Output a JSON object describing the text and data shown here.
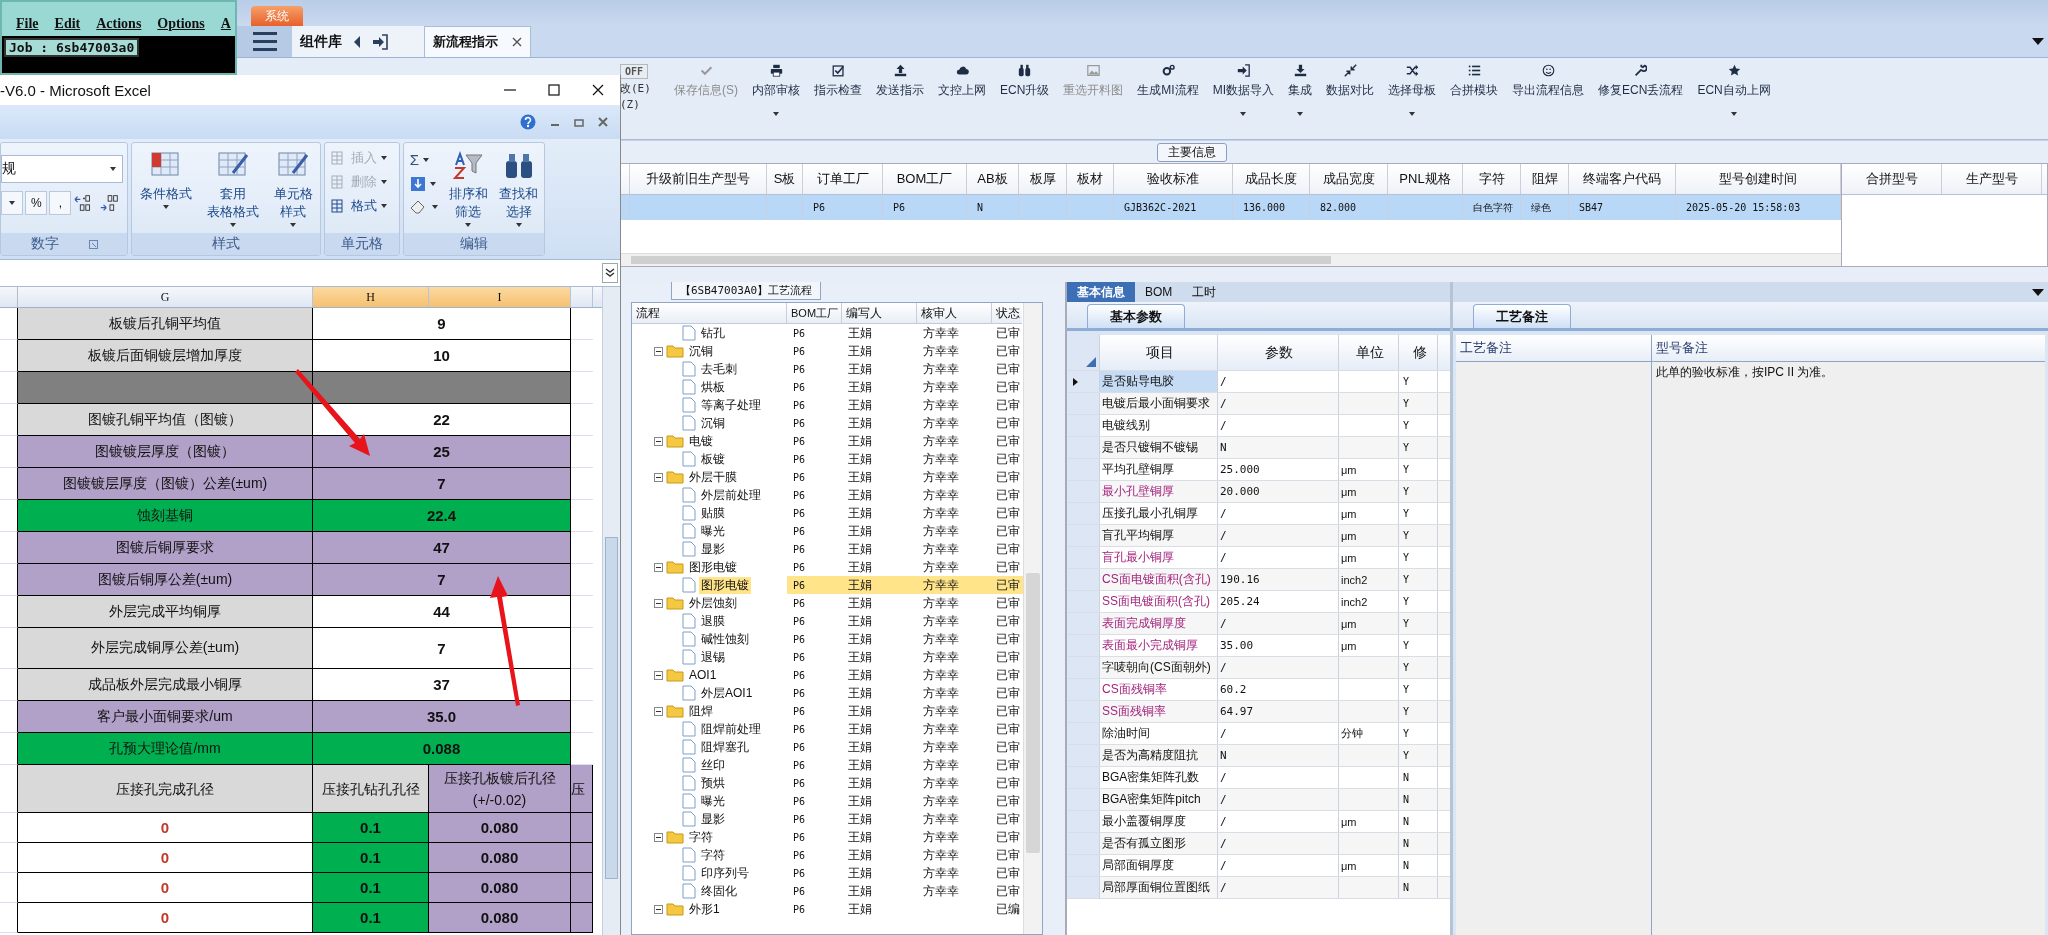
{
  "terminal": {
    "menu": [
      "File",
      "Edit",
      "Actions",
      "Options",
      "A"
    ],
    "job": "Job : 6sb47003a0"
  },
  "excel": {
    "title": "-V6.0 - Microsoft Excel",
    "ribbon": {
      "format_value": "规",
      "number_buttons": [
        "%",
        ","
      ],
      "number_group": "数字",
      "style_group": "样式",
      "style_buttons": [
        {
          "lines": [
            "条件格式"
          ]
        },
        {
          "lines": [
            "套用",
            "表格格式"
          ]
        },
        {
          "lines": [
            "单元格",
            "样式"
          ]
        }
      ],
      "cells_group": "单元格",
      "cells_buttons": [
        {
          "label": "插入",
          "disabled": true
        },
        {
          "label": "删除",
          "disabled": true
        },
        {
          "label": "格式",
          "disabled": false
        }
      ],
      "edit_group": "编辑",
      "sum": "Σ",
      "edit_buttons": [
        {
          "lines": [
            "排序和",
            "筛选"
          ]
        },
        {
          "lines": [
            "查找和",
            "选择"
          ]
        }
      ]
    },
    "columns": [
      "G",
      "H",
      "I"
    ],
    "rows": [
      {
        "label": "板镀后孔铜平均值",
        "value": "9",
        "kind": "plain"
      },
      {
        "label": "板镀后面铜镀层增加厚度",
        "value": "10",
        "kind": "plain"
      },
      {
        "kind": "blank"
      },
      {
        "label": "图镀孔铜平均值（图镀）",
        "value": "22",
        "kind": "plain"
      },
      {
        "label": "图镀镀层厚度（图镀）",
        "value": "25",
        "kind": "purple"
      },
      {
        "label": "图镀镀层厚度（图镀）公差(±um)",
        "value": "7",
        "kind": "purple"
      },
      {
        "label": "蚀刻基铜",
        "value": "22.4",
        "kind": "green"
      },
      {
        "label": "图镀后铜厚要求",
        "value": "47",
        "kind": "purple"
      },
      {
        "label": "图镀后铜厚公差(±um)",
        "value": "7",
        "kind": "purple"
      },
      {
        "label": "外层完成平均铜厚",
        "value": "44",
        "kind": "plain"
      },
      {
        "label": "外层完成铜厚公差(±um)",
        "value": "7",
        "kind": "plain"
      },
      {
        "label": "成品板外层完成最小铜厚",
        "value": "37",
        "kind": "plain"
      },
      {
        "label": "客户最小面铜要求/um",
        "value": "35.0",
        "kind": "purple"
      },
      {
        "label": "孔预大理论值/mm",
        "value": "0.088",
        "kind": "green"
      }
    ],
    "press_header": [
      {
        "lines": [
          "压接孔完成孔径"
        ]
      },
      {
        "lines": [
          "压接孔钻孔孔径"
        ]
      },
      {
        "lines": [
          "压接孔板镀后孔径",
          "(+/-0.02)"
        ]
      },
      {
        "lines": [
          "压"
        ]
      }
    ],
    "press_rows": [
      {
        "finished": "0",
        "drill": "0.1",
        "plated": "0.080"
      },
      {
        "finished": "0",
        "drill": "0.1",
        "plated": "0.080"
      },
      {
        "finished": "0",
        "drill": "0.1",
        "plated": "0.080"
      },
      {
        "finished": "0",
        "drill": "0.1",
        "plated": "0.080"
      }
    ]
  },
  "app": {
    "system_tab": "系统",
    "library": "组件库",
    "doc_tab": {
      "label": "新流程指示",
      "selected": true
    },
    "toolbar": {
      "off": "OFF",
      "hints": [
        "改(E)",
        "(Z)"
      ],
      "items": [
        {
          "label": "保存信息(S)",
          "disabled": true,
          "dropdown": false
        },
        {
          "label": "内部审核",
          "disabled": false,
          "dropdown": true
        },
        {
          "label": "指示检查",
          "disabled": false,
          "dropdown": false
        },
        {
          "label": "发送指示",
          "disabled": false,
          "dropdown": false
        },
        {
          "label": "文控上网",
          "disabled": false,
          "dropdown": false
        },
        {
          "label": "ECN升级",
          "disabled": false,
          "dropdown": false
        },
        {
          "label": "重选开料图",
          "disabled": true,
          "dropdown": false
        },
        {
          "label": "生成MI流程",
          "disabled": false,
          "dropdown": false
        },
        {
          "label": "MI数据导入",
          "disabled": false,
          "dropdown": true
        },
        {
          "label": "集成",
          "disabled": false,
          "dropdown": true
        },
        {
          "label": "数据对比",
          "disabled": false,
          "dropdown": false
        },
        {
          "label": "选择母板",
          "disabled": false,
          "dropdown": true
        },
        {
          "label": "合拼模块",
          "disabled": false,
          "dropdown": false
        },
        {
          "label": "导出流程信息",
          "disabled": false,
          "dropdown": false
        },
        {
          "label": "修复ECN丢流程",
          "disabled": false,
          "dropdown": false
        },
        {
          "label": "ECN自动上网",
          "disabled": false,
          "dropdown": true
        }
      ]
    },
    "main_info": {
      "title": "主要信息",
      "columns": [
        "升级前旧生产型号",
        "S板",
        "订单工厂",
        "BOM工厂",
        "AB板",
        "板厚",
        "板材",
        "验收标准",
        "成品长度",
        "成品宽度",
        "PNL规格",
        "字符",
        "阻焊",
        "终端客户代码",
        "型号创建时间"
      ],
      "rows": [
        {
          "selected": true,
          "cells": [
            null,
            null,
            "P6",
            "P6",
            "N",
            null,
            null,
            "GJB362C-2021",
            "136.000",
            "82.000",
            null,
            "白色字符",
            "绿色",
            "SB47",
            "2025-05-20 15:58:03"
          ]
        }
      ],
      "side_columns": [
        "合拼型号",
        "生产型号"
      ]
    },
    "flow": {
      "tab": "【6SB47003A0】工艺流程",
      "columns": [
        "流程",
        "BOM工厂",
        "编写人",
        "核审人",
        "状态"
      ],
      "tree": [
        {
          "name": "钻孔",
          "kind": "file",
          "bom": "P6",
          "writer": "王娟",
          "reviewer": "方幸幸",
          "status": "已审",
          "selected": false
        },
        {
          "name": "沉铜",
          "kind": "folder",
          "expanded": true,
          "bom": "P6",
          "writer": "王娟",
          "reviewer": "方幸幸",
          "status": "已审",
          "selected": false,
          "children": [
            {
              "name": "去毛刺",
              "kind": "file",
              "bom": "P6",
              "writer": "王娟",
              "reviewer": "方幸幸",
              "status": "已审",
              "selected": false
            },
            {
              "name": "烘板",
              "kind": "file",
              "bom": "P6",
              "writer": "王娟",
              "reviewer": "方幸幸",
              "status": "已审",
              "selected": false
            },
            {
              "name": "等离子处理",
              "kind": "file",
              "bom": "P6",
              "writer": "王娟",
              "reviewer": "方幸幸",
              "status": "已审",
              "selected": false
            },
            {
              "name": "沉铜",
              "kind": "file",
              "bom": "P6",
              "writer": "王娟",
              "reviewer": "方幸幸",
              "status": "已审",
              "selected": false
            }
          ]
        },
        {
          "name": "电镀",
          "kind": "folder",
          "expanded": true,
          "bom": "P6",
          "writer": "王娟",
          "reviewer": "方幸幸",
          "status": "已审",
          "selected": false,
          "children": [
            {
              "name": "板镀",
              "kind": "file",
              "bom": "P6",
              "writer": "王娟",
              "reviewer": "方幸幸",
              "status": "已审",
              "selected": false
            }
          ]
        },
        {
          "name": "外层干膜",
          "kind": "folder",
          "expanded": true,
          "bom": "P6",
          "writer": "王娟",
          "reviewer": "方幸幸",
          "status": "已审",
          "selected": false,
          "children": [
            {
              "name": "外层前处理",
              "kind": "file",
              "bom": "P6",
              "writer": "王娟",
              "reviewer": "方幸幸",
              "status": "已审",
              "selected": false
            },
            {
              "name": "贴膜",
              "kind": "file",
              "bom": "P6",
              "writer": "王娟",
              "reviewer": "方幸幸",
              "status": "已审",
              "selected": false
            },
            {
              "name": "曝光",
              "kind": "file",
              "bom": "P6",
              "writer": "王娟",
              "reviewer": "方幸幸",
              "status": "已审",
              "selected": false
            },
            {
              "name": "显影",
              "kind": "file",
              "bom": "P6",
              "writer": "王娟",
              "reviewer": "方幸幸",
              "status": "已审",
              "selected": false
            }
          ]
        },
        {
          "name": "图形电镀",
          "kind": "folder",
          "expanded": true,
          "bom": "P6",
          "writer": "王娟",
          "reviewer": "方幸幸",
          "status": "已审",
          "selected": false,
          "children": [
            {
              "name": "图形电镀",
              "kind": "file",
              "bom": "P6",
              "writer": "王娟",
              "reviewer": "方幸幸",
              "status": "已审",
              "selected": true
            }
          ]
        },
        {
          "name": "外层蚀刻",
          "kind": "folder",
          "expanded": true,
          "bom": "P6",
          "writer": "王娟",
          "reviewer": "方幸幸",
          "status": "已审",
          "selected": false,
          "children": [
            {
              "name": "退膜",
              "kind": "file",
              "bom": "P6",
              "writer": "王娟",
              "reviewer": "方幸幸",
              "status": "已审",
              "selected": false
            },
            {
              "name": "碱性蚀刻",
              "kind": "file",
              "bom": "P6",
              "writer": "王娟",
              "reviewer": "方幸幸",
              "status": "已审",
              "selected": false
            },
            {
              "name": "退锡",
              "kind": "file",
              "bom": "P6",
              "writer": "王娟",
              "reviewer": "方幸幸",
              "status": "已审",
              "selected": false
            }
          ]
        },
        {
          "name": "AOI1",
          "kind": "folder",
          "expanded": true,
          "bom": "P6",
          "writer": "王娟",
          "reviewer": "方幸幸",
          "status": "已审",
          "selected": false,
          "children": [
            {
              "name": "外层AOI1",
              "kind": "file",
              "bom": "P6",
              "writer": "王娟",
              "reviewer": "方幸幸",
              "status": "已审",
              "selected": false
            }
          ]
        },
        {
          "name": "阻焊",
          "kind": "folder",
          "expanded": true,
          "bom": "P6",
          "writer": "王娟",
          "reviewer": "方幸幸",
          "status": "已审",
          "selected": false,
          "children": [
            {
              "name": "阻焊前处理",
              "kind": "file",
              "bom": "P6",
              "writer": "王娟",
              "reviewer": "方幸幸",
              "status": "已审",
              "selected": false
            },
            {
              "name": "阻焊塞孔",
              "kind": "file",
              "bom": "P6",
              "writer": "王娟",
              "reviewer": "方幸幸",
              "status": "已审",
              "selected": false
            },
            {
              "name": "丝印",
              "kind": "file",
              "bom": "P6",
              "writer": "王娟",
              "reviewer": "方幸幸",
              "status": "已审",
              "selected": false
            },
            {
              "name": "预烘",
              "kind": "file",
              "bom": "P6",
              "writer": "王娟",
              "reviewer": "方幸幸",
              "status": "已审",
              "selected": false
            },
            {
              "name": "曝光",
              "kind": "file",
              "bom": "P6",
              "writer": "王娟",
              "reviewer": "方幸幸",
              "status": "已审",
              "selected": false
            },
            {
              "name": "显影",
              "kind": "file",
              "bom": "P6",
              "writer": "王娟",
              "reviewer": "方幸幸",
              "status": "已审",
              "selected": false
            }
          ]
        },
        {
          "name": "字符",
          "kind": "folder",
          "expanded": true,
          "bom": "P6",
          "writer": "王娟",
          "reviewer": "方幸幸",
          "status": "已审",
          "selected": false,
          "children": [
            {
              "name": "字符",
              "kind": "file",
              "bom": "P6",
              "writer": "王娟",
              "reviewer": "方幸幸",
              "status": "已审",
              "selected": false
            },
            {
              "name": "印序列号",
              "kind": "file",
              "bom": "P6",
              "writer": "王娟",
              "reviewer": "方幸幸",
              "status": "已审",
              "selected": false
            },
            {
              "name": "终固化",
              "kind": "file",
              "bom": "P6",
              "writer": "王娟",
              "reviewer": "方幸幸",
              "status": "已审",
              "selected": false
            }
          ]
        },
        {
          "name": "外形1",
          "kind": "folder",
          "expanded": true,
          "bom": "P6",
          "writer": "王娟",
          "status": "已编",
          "selected": false
        }
      ]
    },
    "details": {
      "tabs": [
        {
          "label": "基本信息",
          "selected": true
        },
        {
          "label": "BOM",
          "selected": false
        },
        {
          "label": "工时",
          "selected": false
        }
      ],
      "subtab": "基本参数",
      "columns": [
        "项目",
        "参数",
        "单位",
        "修"
      ],
      "rows": [
        {
          "name": "是否贴导电胶",
          "value": "/",
          "modified": "Y",
          "highlighted": false,
          "selected": true
        },
        {
          "name": "电镀后最小面铜要求",
          "value": "/",
          "modified": "Y",
          "highlighted": false,
          "selected": false
        },
        {
          "name": "电镀线别",
          "value": "/",
          "modified": "Y",
          "highlighted": false,
          "selected": false
        },
        {
          "name": "是否只镀铜不镀锡",
          "value": "N",
          "modified": "Y",
          "highlighted": false,
          "selected": false
        },
        {
          "name": "平均孔壁铜厚",
          "value": "25.000",
          "unit": "μm",
          "modified": "Y",
          "highlighted": false,
          "selected": false
        },
        {
          "name": "最小孔壁铜厚",
          "value": "20.000",
          "unit": "μm",
          "modified": "Y",
          "highlighted": true,
          "selected": false
        },
        {
          "name": "压接孔最小孔铜厚",
          "value": "/",
          "unit": "μm",
          "modified": "Y",
          "highlighted": false,
          "selected": false
        },
        {
          "name": "盲孔平均铜厚",
          "value": "/",
          "unit": "μm",
          "modified": "Y",
          "highlighted": false,
          "selected": false
        },
        {
          "name": "盲孔最小铜厚",
          "value": "/",
          "unit": "μm",
          "modified": "Y",
          "highlighted": true,
          "selected": false
        },
        {
          "name": "CS面电镀面积(含孔)",
          "value": "190.16",
          "unit": "inch2",
          "modified": "Y",
          "highlighted": true,
          "selected": false
        },
        {
          "name": "SS面电镀面积(含孔)",
          "value": "205.24",
          "unit": "inch2",
          "modified": "Y",
          "highlighted": true,
          "selected": false
        },
        {
          "name": "表面完成铜厚度",
          "value": "/",
          "unit": "μm",
          "modified": "Y",
          "highlighted": true,
          "selected": false
        },
        {
          "name": "表面最小完成铜厚",
          "value": "35.00",
          "unit": "μm",
          "modified": "Y",
          "highlighted": true,
          "selected": false
        },
        {
          "name": "字唛朝向(CS面朝外)",
          "value": "/",
          "modified": "Y",
          "highlighted": false,
          "selected": false
        },
        {
          "name": "CS面残铜率",
          "value": "60.2",
          "modified": "Y",
          "highlighted": true,
          "selected": false
        },
        {
          "name": "SS面残铜率",
          "value": "64.97",
          "modified": "Y",
          "highlighted": true,
          "selected": false
        },
        {
          "name": "除油时间",
          "value": "/",
          "unit": "分钟",
          "modified": "Y",
          "highlighted": false,
          "selected": false
        },
        {
          "name": "是否为高精度阻抗",
          "value": "N",
          "modified": "Y",
          "highlighted": false,
          "selected": false
        },
        {
          "name": "BGA密集矩阵孔数",
          "value": "/",
          "modified": "N",
          "highlighted": false,
          "selected": false
        },
        {
          "name": "BGA密集矩阵pitch",
          "value": "/",
          "modified": "N",
          "highlighted": false,
          "selected": false
        },
        {
          "name": "最小盖覆铜厚度",
          "value": "/",
          "unit": "μm",
          "modified": "N",
          "highlighted": false,
          "selected": false
        },
        {
          "name": "是否有孤立图形",
          "value": "/",
          "modified": "N",
          "highlighted": false,
          "selected": false
        },
        {
          "name": "局部面铜厚度",
          "value": "/",
          "unit": "μm",
          "modified": "N",
          "highlighted": false,
          "selected": false
        },
        {
          "name": "局部厚面铜位置图纸",
          "value": "/",
          "modified": "N",
          "highlighted": false,
          "selected": false
        }
      ]
    },
    "remarks": {
      "tab": "工艺备注",
      "columns": [
        "工艺备注",
        "型号备注"
      ],
      "model_note": "此单的验收标准，按IPC II 为准。"
    }
  }
}
